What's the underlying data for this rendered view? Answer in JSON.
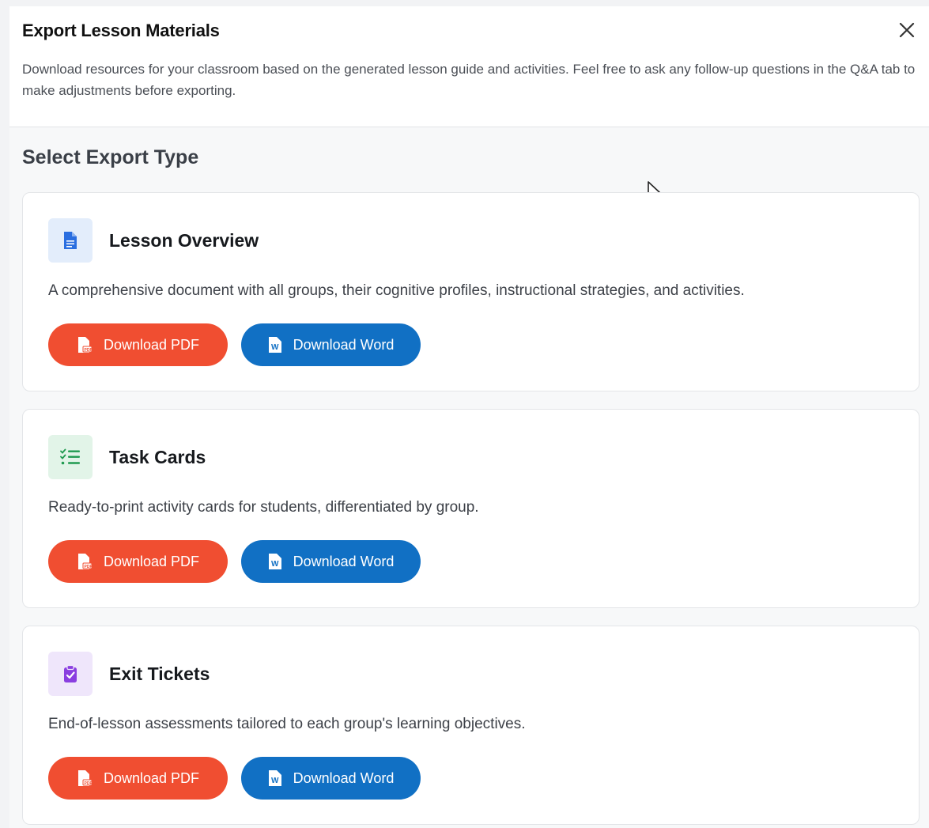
{
  "dialog": {
    "title": "Export Lesson Materials",
    "description": "Download resources for your classroom based on the generated lesson guide and activities. Feel free to ask any follow-up questions in the Q&A tab to make adjustments before exporting."
  },
  "section": {
    "title": "Select Export Type"
  },
  "cards": [
    {
      "title": "Lesson Overview",
      "description": "A comprehensive document with all groups, their cognitive profiles, instructional strategies, and activities.",
      "icon": "document-icon",
      "pdf_label": "Download PDF",
      "word_label": "Download Word"
    },
    {
      "title": "Task Cards",
      "description": "Ready-to-print activity cards for students, differentiated by group.",
      "icon": "checklist-icon",
      "pdf_label": "Download PDF",
      "word_label": "Download Word"
    },
    {
      "title": "Exit Tickets",
      "description": "End-of-lesson assessments tailored to each group's learning objectives.",
      "icon": "clipboard-check-icon",
      "pdf_label": "Download PDF",
      "word_label": "Download Word"
    }
  ],
  "colors": {
    "pdf_button": "#f04e31",
    "word_button": "#1170c4",
    "icon_blue": "#2a6ee0",
    "icon_green": "#1f9a4f",
    "icon_purple": "#8a3ee0"
  }
}
